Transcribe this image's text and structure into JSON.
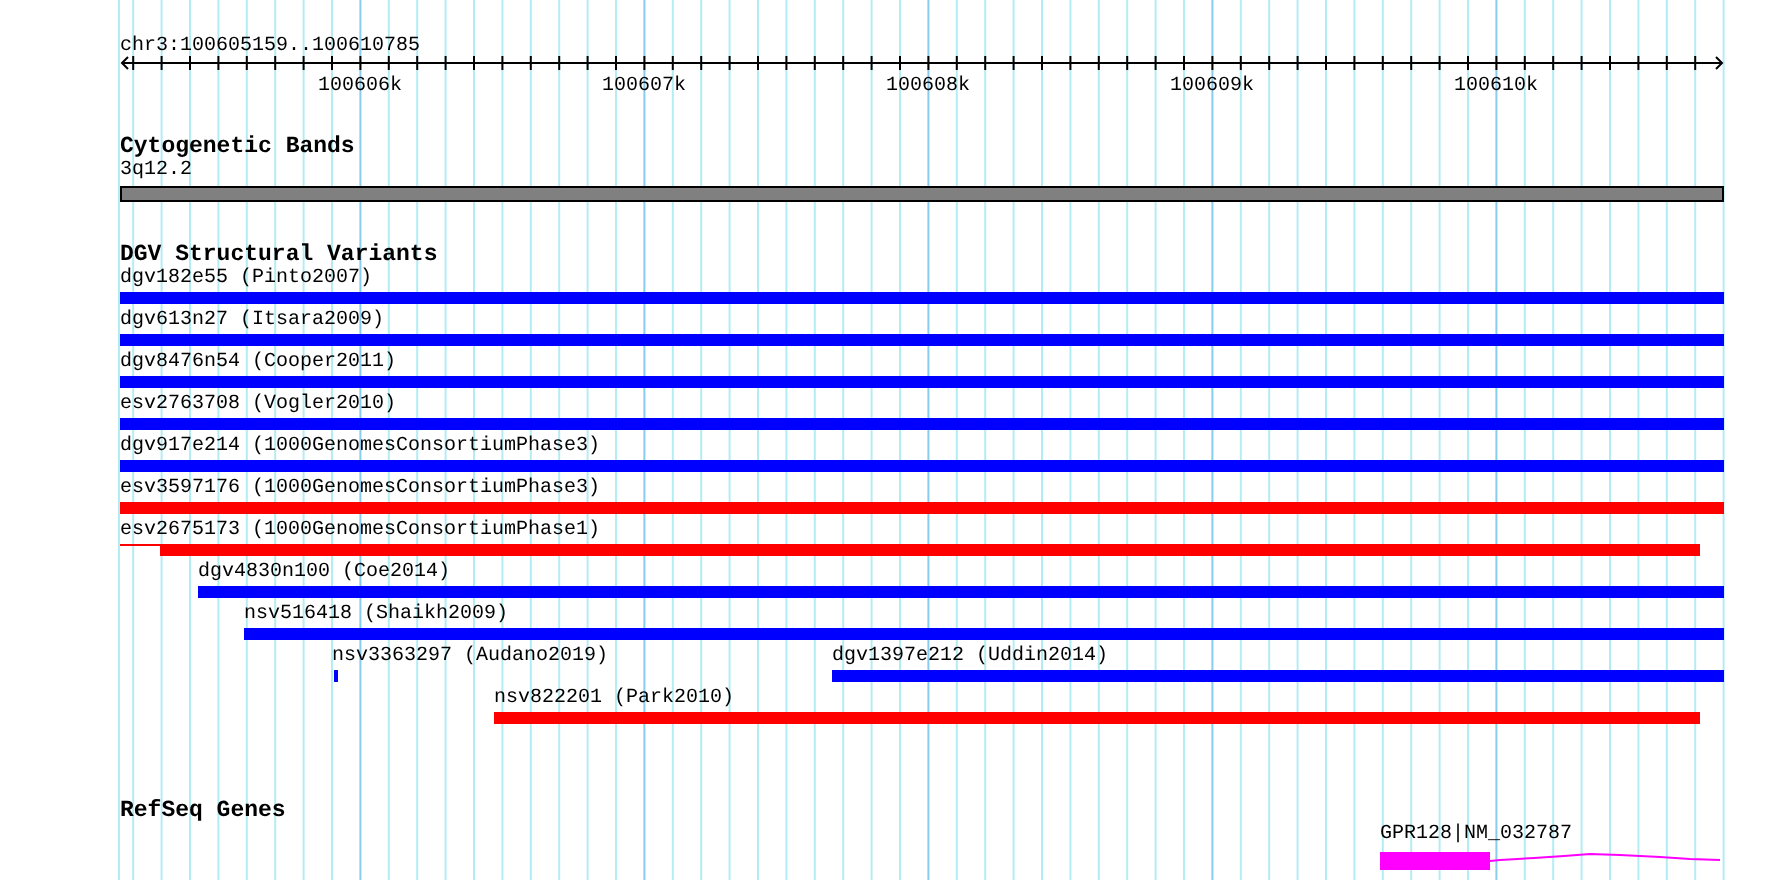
{
  "ruler": {
    "range": "chr3:100605159..100610785",
    "ticks": [
      "100606k",
      "100607k",
      "100608k",
      "100609k",
      "100610k"
    ]
  },
  "tracks": [
    {
      "kind": "cytoband",
      "title": "Cytogenetic Bands",
      "features": [
        {
          "label": "3q12.2"
        }
      ]
    },
    {
      "kind": "variants",
      "title": "DGV Structural Variants",
      "features": [
        {
          "label": "dgv182e55 (Pinto2007)",
          "color": "#0000ff"
        },
        {
          "label": "dgv613n27 (Itsara2009)",
          "color": "#0000ff"
        },
        {
          "label": "dgv8476n54 (Cooper2011)",
          "color": "#0000ff"
        },
        {
          "label": "esv2763708 (Vogler2010)",
          "color": "#0000ff"
        },
        {
          "label": "dgv917e214 (1000GenomesConsortiumPhase3)",
          "color": "#0000ff"
        },
        {
          "label": "esv3597176 (1000GenomesConsortiumPhase3)",
          "color": "#ff0000"
        },
        {
          "label": "esv2675173 (1000GenomesConsortiumPhase1)",
          "color": "#ff0000"
        },
        {
          "label": "dgv4830n100 (Coe2014)",
          "color": "#0000ff"
        },
        {
          "label": "nsv516418 (Shaikh2009)",
          "color": "#0000ff"
        },
        {
          "label": "nsv3363297 (Audano2019)",
          "color": "#0000ff"
        },
        {
          "label": "dgv1397e212 (Uddin2014)",
          "color": "#0000ff"
        },
        {
          "label": "nsv822201 (Park2010)",
          "color": "#ff0000"
        }
      ]
    },
    {
      "kind": "genes",
      "title": "RefSeq Genes",
      "features": [
        {
          "label": "GPR128|NM_032787"
        }
      ]
    }
  ]
}
